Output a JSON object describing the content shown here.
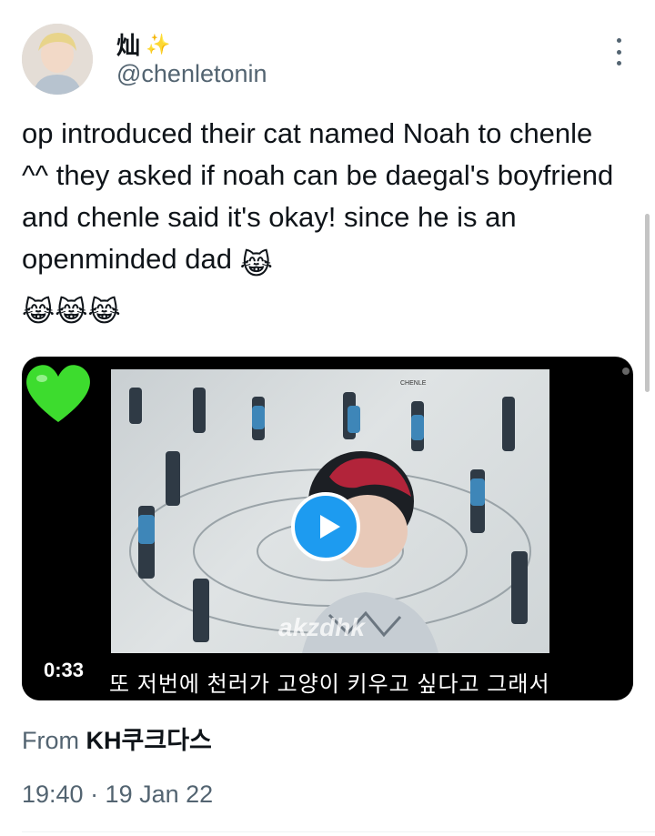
{
  "author": {
    "display_name": "灿",
    "name_emoji": "✨",
    "handle": "@chenletonin",
    "avatar_icon": "avatar-photo"
  },
  "tweet": {
    "text": "op introduced their cat named Noah to chenle ^^ they asked if noah can be daegal's boyfriend and chenle said it's okay! since he is an openminded dad",
    "trailing_emoji": "😹",
    "extra_emojis": "😹😹😹"
  },
  "video": {
    "duration": "0:33",
    "subtitle": "또 저번에 천러가 고양이 키우고 싶다고 그래서",
    "watermark": "akzdhk",
    "overlay_emoji_icon": "green-heart-icon",
    "play_icon": "play-icon"
  },
  "meta": {
    "source_prefix": "From",
    "source_app": "KH쿠크다스",
    "timestamp": "19:40 · 19 Jan 22"
  },
  "colors": {
    "accent": "#1d9bf0",
    "text_primary": "#0f1419",
    "text_secondary": "#536471"
  }
}
